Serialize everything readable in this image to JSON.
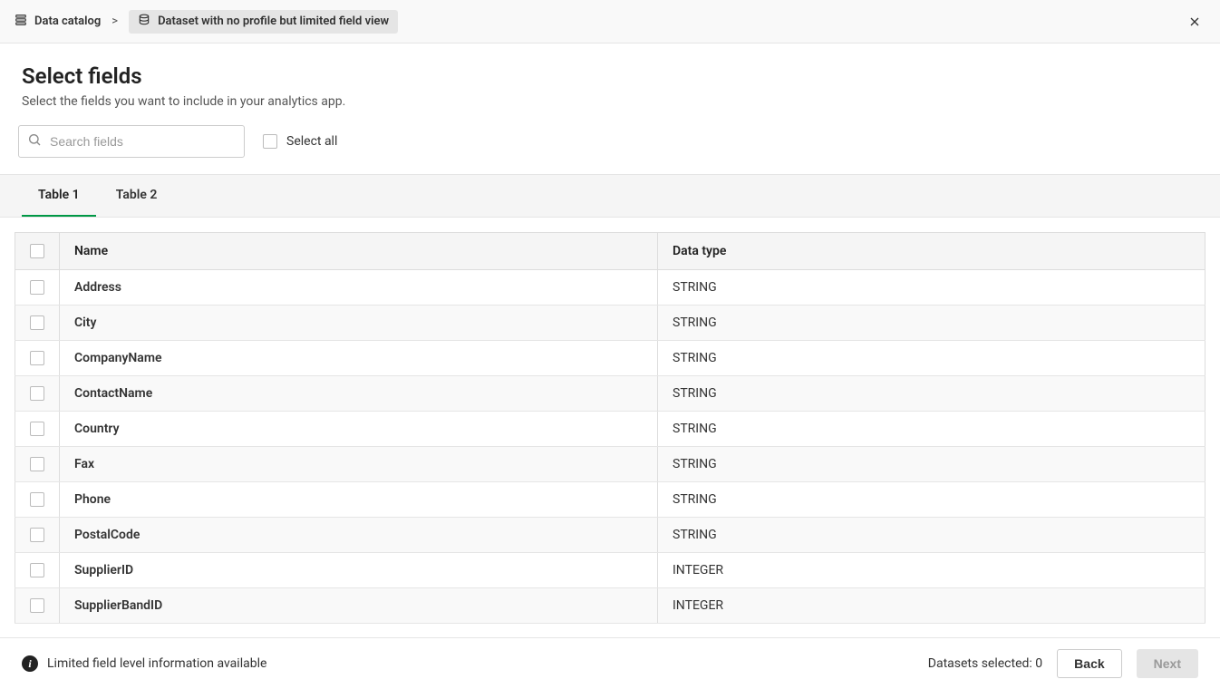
{
  "breadcrumbs": {
    "root": "Data catalog",
    "separator": ">",
    "current": "Dataset with no profile but limited field view"
  },
  "header": {
    "title": "Select fields",
    "subtitle": "Select the fields you want to include in your analytics app."
  },
  "toolbar": {
    "search_placeholder": "Search fields",
    "select_all_label": "Select all"
  },
  "tabs": [
    {
      "label": "Table 1",
      "active": true
    },
    {
      "label": "Table 2",
      "active": false
    }
  ],
  "table": {
    "columns": {
      "name": "Name",
      "data_type": "Data type"
    },
    "rows": [
      {
        "name": "Address",
        "type": "STRING"
      },
      {
        "name": "City",
        "type": "STRING"
      },
      {
        "name": "CompanyName",
        "type": "STRING"
      },
      {
        "name": "ContactName",
        "type": "STRING"
      },
      {
        "name": "Country",
        "type": "STRING"
      },
      {
        "name": "Fax",
        "type": "STRING"
      },
      {
        "name": "Phone",
        "type": "STRING"
      },
      {
        "name": "PostalCode",
        "type": "STRING"
      },
      {
        "name": "SupplierID",
        "type": "INTEGER"
      },
      {
        "name": "SupplierBandID",
        "type": "INTEGER"
      }
    ]
  },
  "footer": {
    "info_message": "Limited field level information available",
    "selected_label": "Datasets selected:",
    "selected_count": "0",
    "back_label": "Back",
    "next_label": "Next"
  }
}
